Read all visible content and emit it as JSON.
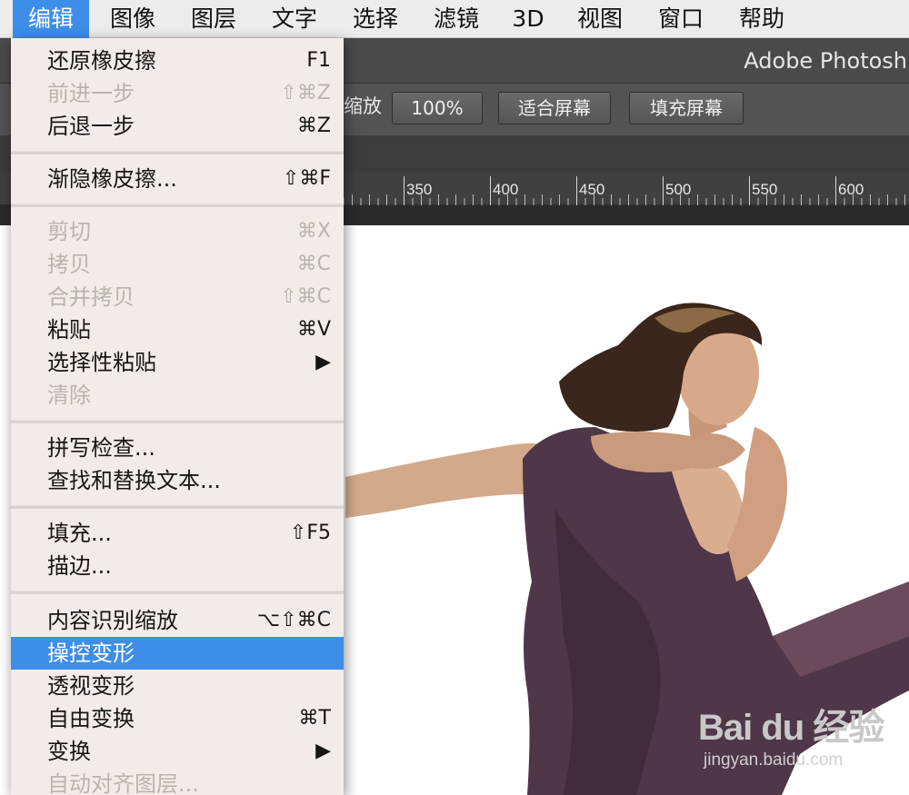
{
  "menubar": {
    "items": [
      "编辑",
      "图像",
      "图层",
      "文字",
      "选择",
      "滤镜",
      "3D",
      "视图",
      "窗口",
      "帮助"
    ],
    "active_index": 0
  },
  "app_title": "Adobe Photosh",
  "options_bar": {
    "zoom_label": "缩放",
    "btn_100": "100%",
    "btn_fit": "适合屏幕",
    "btn_fill": "填充屏幕"
  },
  "ruler": {
    "ticks": [
      "350",
      "400",
      "450",
      "500",
      "550",
      "600"
    ]
  },
  "edit_menu": {
    "items": [
      {
        "label": "还原橡皮擦",
        "shortcut": "F1",
        "state": "normal"
      },
      {
        "label": "前进一步",
        "shortcut": "⇧⌘Z",
        "state": "disabled"
      },
      {
        "label": "后退一步",
        "shortcut": "⌘Z",
        "state": "normal"
      },
      {
        "label": "渐隐橡皮擦...",
        "shortcut": "⇧⌘F",
        "state": "normal"
      },
      {
        "label": "剪切",
        "shortcut": "⌘X",
        "state": "disabled"
      },
      {
        "label": "拷贝",
        "shortcut": "⌘C",
        "state": "disabled"
      },
      {
        "label": "合并拷贝",
        "shortcut": "⇧⌘C",
        "state": "disabled"
      },
      {
        "label": "粘贴",
        "shortcut": "⌘V",
        "state": "normal"
      },
      {
        "label": "选择性粘贴",
        "shortcut": "▶",
        "state": "normal"
      },
      {
        "label": "清除",
        "shortcut": "",
        "state": "disabled"
      },
      {
        "label": "拼写检查...",
        "shortcut": "",
        "state": "normal"
      },
      {
        "label": "查找和替换文本...",
        "shortcut": "",
        "state": "normal"
      },
      {
        "label": "填充...",
        "shortcut": "⇧F5",
        "state": "normal"
      },
      {
        "label": "描边...",
        "shortcut": "",
        "state": "normal"
      },
      {
        "label": "内容识别缩放",
        "shortcut": "⌥⇧⌘C",
        "state": "normal"
      },
      {
        "label": "操控变形",
        "shortcut": "",
        "state": "selected"
      },
      {
        "label": "透视变形",
        "shortcut": "",
        "state": "normal"
      },
      {
        "label": "自由变换",
        "shortcut": "⌘T",
        "state": "normal"
      },
      {
        "label": "变换",
        "shortcut": "▶",
        "state": "normal"
      },
      {
        "label": "自动对齐图层...",
        "shortcut": "",
        "state": "disabled"
      }
    ]
  },
  "watermark": {
    "logo_text": "Bai du 经验",
    "url": "jingyan.baidu.com"
  },
  "colors": {
    "menu_highlight": "#3d8ee8",
    "menu_bg": "#f1ece9",
    "ps_chrome": "#535353"
  }
}
